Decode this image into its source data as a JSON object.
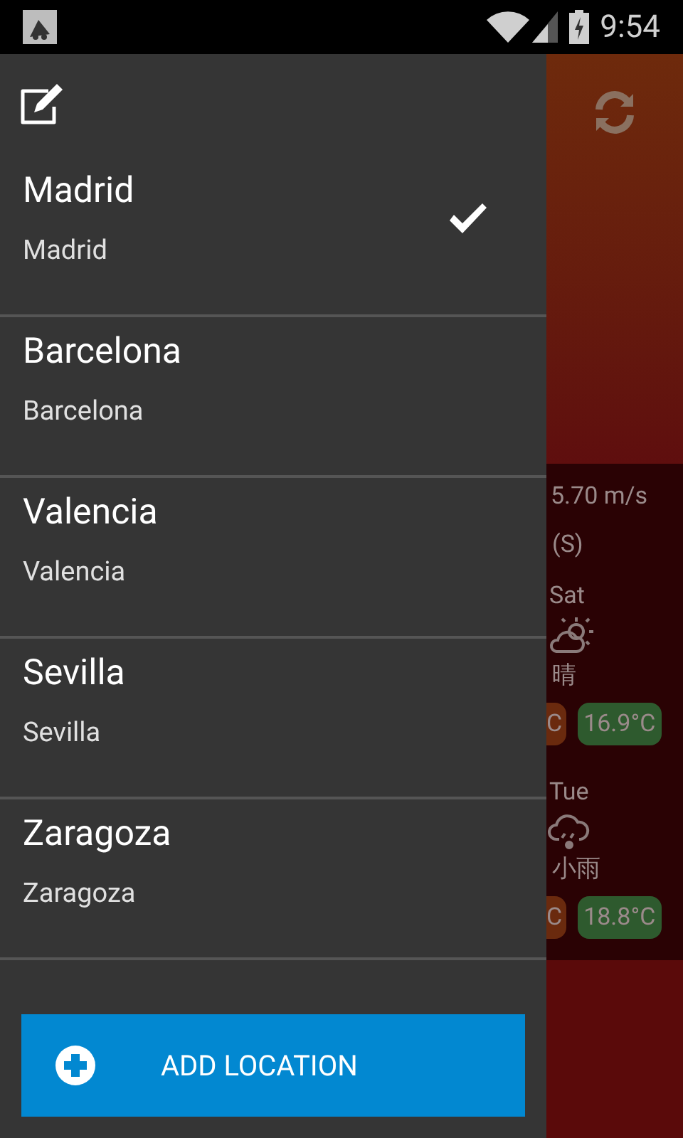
{
  "status_bar": {
    "time": "9:54"
  },
  "drawer": {
    "locations": [
      {
        "name": "Madrid",
        "subtitle": "Madrid",
        "selected": true
      },
      {
        "name": "Barcelona",
        "subtitle": "Barcelona",
        "selected": false
      },
      {
        "name": "Valencia",
        "subtitle": "Valencia",
        "selected": false
      },
      {
        "name": "Sevilla",
        "subtitle": "Sevilla",
        "selected": false
      },
      {
        "name": "Zaragoza",
        "subtitle": "Zaragoza",
        "selected": false
      }
    ],
    "add_button": "ADD LOCATION"
  },
  "weather": {
    "wind_speed": "5.70 m/s",
    "wind_direction": "(S)",
    "forecast": [
      {
        "day": "Sat",
        "kind": "partly-sunny",
        "condition": "晴",
        "low": "C",
        "high": "16.9°C"
      },
      {
        "day": "Tue",
        "kind": "rain",
        "condition": "小雨",
        "low": "C",
        "high": "18.8°C"
      }
    ]
  }
}
